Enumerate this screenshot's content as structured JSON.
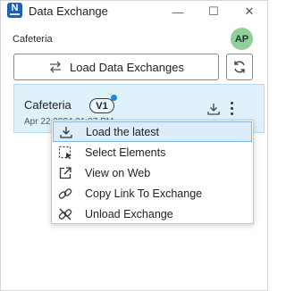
{
  "window": {
    "title": "Data Exchange",
    "logo_letter": "N",
    "controls": {
      "minimize": "—",
      "maximize": "☐",
      "close": "✕"
    }
  },
  "header": {
    "project_name": "Cafeteria",
    "avatar_initials": "AP"
  },
  "toolbar": {
    "load_label": "Load Data Exchanges"
  },
  "exchange_card": {
    "name": "Cafeteria",
    "version": "V1",
    "date": "Apr 22 2024 01:07 PM"
  },
  "context_menu": {
    "items": [
      {
        "label": "Load the latest",
        "icon": "download-icon"
      },
      {
        "label": "Select Elements",
        "icon": "select-elements-icon"
      },
      {
        "label": "View on Web",
        "icon": "external-link-icon"
      },
      {
        "label": "Copy Link To Exchange",
        "icon": "link-icon"
      },
      {
        "label": "Unload Exchange",
        "icon": "unlink-icon"
      }
    ]
  },
  "colors": {
    "card_bg": "#dff1fa",
    "menu_highlight": "#dcedf9",
    "avatar_bg": "#8fcf9a",
    "version_dot": "#1a8ad8",
    "logo_bg": "#1f5fb4"
  }
}
